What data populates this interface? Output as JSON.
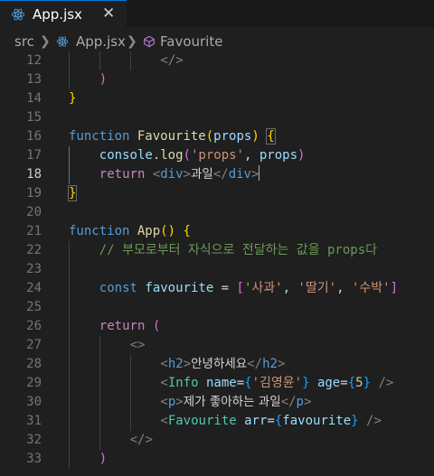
{
  "tab": {
    "label": "App.jsx",
    "close": "✕"
  },
  "breadcrumb": {
    "folder": "src",
    "file": "App.jsx",
    "symbol": "Favourite"
  },
  "editor": {
    "active_line": 18,
    "line_numbers": [
      "12",
      "13",
      "14",
      "15",
      "16",
      "17",
      "18",
      "19",
      "20",
      "21",
      "22",
      "23",
      "24",
      "25",
      "26",
      "27",
      "28",
      "29",
      "30",
      "31",
      "32",
      "33"
    ],
    "lines": [
      [
        [
          "ang",
          "</"
        ],
        [
          "ang",
          ">"
        ]
      ],
      [
        [
          "p2",
          ")"
        ]
      ],
      [
        [
          "p1",
          "}"
        ]
      ],
      [],
      [
        [
          "kw",
          "function"
        ],
        [
          "txt0",
          " "
        ],
        [
          "fn",
          "Favourite"
        ],
        [
          "p1",
          "("
        ],
        [
          "var",
          "props"
        ],
        [
          "p1",
          ")"
        ],
        [
          "txt0",
          " "
        ],
        [
          "p1",
          "{"
        ]
      ],
      [
        [
          "var",
          "console"
        ],
        [
          "txt0",
          "."
        ],
        [
          "fn",
          "log"
        ],
        [
          "p2",
          "("
        ],
        [
          "str",
          "'props'"
        ],
        [
          "txt0",
          ", "
        ],
        [
          "var",
          "props"
        ],
        [
          "p2",
          ")"
        ]
      ],
      [
        [
          "ctl",
          "return"
        ],
        [
          "txt0",
          " "
        ],
        [
          "ang",
          "<"
        ],
        [
          "tag",
          "div"
        ],
        [
          "ang",
          ">"
        ],
        [
          "txt",
          "과일"
        ],
        [
          "ang",
          "</"
        ],
        [
          "tag",
          "div"
        ],
        [
          "ang",
          ">"
        ]
      ],
      [
        [
          "p1",
          "}"
        ]
      ],
      [],
      [
        [
          "kw",
          "function"
        ],
        [
          "txt0",
          " "
        ],
        [
          "fn",
          "App"
        ],
        [
          "p1",
          "()"
        ],
        [
          "txt0",
          " "
        ],
        [
          "p1",
          "{"
        ]
      ],
      [
        [
          "cmt",
          "// 부모로부터 자식으로 전달하는 값을 props다"
        ]
      ],
      [],
      [
        [
          "kw",
          "const"
        ],
        [
          "txt0",
          " "
        ],
        [
          "var",
          "favourite"
        ],
        [
          "txt0",
          " = "
        ],
        [
          "p2",
          "["
        ],
        [
          "str",
          "'사과'"
        ],
        [
          "txt0",
          ", "
        ],
        [
          "str",
          "'딸기'"
        ],
        [
          "txt0",
          ", "
        ],
        [
          "str",
          "'수박'"
        ],
        [
          "p2",
          "]"
        ]
      ],
      [],
      [
        [
          "ctl",
          "return"
        ],
        [
          "txt0",
          " "
        ],
        [
          "p2",
          "("
        ]
      ],
      [
        [
          "ang",
          "<>"
        ]
      ],
      [
        [
          "ang",
          "<"
        ],
        [
          "tag",
          "h2"
        ],
        [
          "ang",
          ">"
        ],
        [
          "txt",
          "안녕하세요"
        ],
        [
          "ang",
          "</"
        ],
        [
          "tag",
          "h2"
        ],
        [
          "ang",
          ">"
        ]
      ],
      [
        [
          "ang",
          "<"
        ],
        [
          "comp",
          "Info"
        ],
        [
          "txt0",
          " "
        ],
        [
          "attr",
          "name"
        ],
        [
          "txt0",
          "="
        ],
        [
          "p3",
          "{"
        ],
        [
          "str",
          "'김영윤'"
        ],
        [
          "p3",
          "}"
        ],
        [
          "txt0",
          " "
        ],
        [
          "attr",
          "age"
        ],
        [
          "txt0",
          "="
        ],
        [
          "p3",
          "{"
        ],
        [
          "num",
          "5"
        ],
        [
          "p3",
          "}"
        ],
        [
          "txt0",
          " "
        ],
        [
          "ang",
          "/>"
        ]
      ],
      [
        [
          "ang",
          "<"
        ],
        [
          "tag",
          "p"
        ],
        [
          "ang",
          ">"
        ],
        [
          "txt",
          "제가 좋아하는 과일"
        ],
        [
          "ang",
          "</"
        ],
        [
          "tag",
          "p"
        ],
        [
          "ang",
          ">"
        ]
      ],
      [
        [
          "ang",
          "<"
        ],
        [
          "comp",
          "Favourite"
        ],
        [
          "txt0",
          " "
        ],
        [
          "attr",
          "arr"
        ],
        [
          "txt0",
          "="
        ],
        [
          "p3",
          "{"
        ],
        [
          "var",
          "favourite"
        ],
        [
          "p3",
          "}"
        ],
        [
          "txt0",
          " "
        ],
        [
          "ang",
          "/>"
        ]
      ],
      [
        [
          "ang",
          "</>"
        ]
      ],
      [
        [
          "p2",
          ")"
        ]
      ]
    ]
  },
  "colors": {
    "background": "#1f1f1f",
    "keyword": "#569cd6",
    "control": "#c586c0",
    "function": "#dcdcaa",
    "variable": "#9cdcfe",
    "string": "#ce9178",
    "comment": "#6a9955",
    "component": "#4ec9b0"
  },
  "icons": {
    "tab": "react-icon",
    "breadcrumb_file": "react-icon",
    "breadcrumb_symbol": "symbol-method-icon"
  }
}
